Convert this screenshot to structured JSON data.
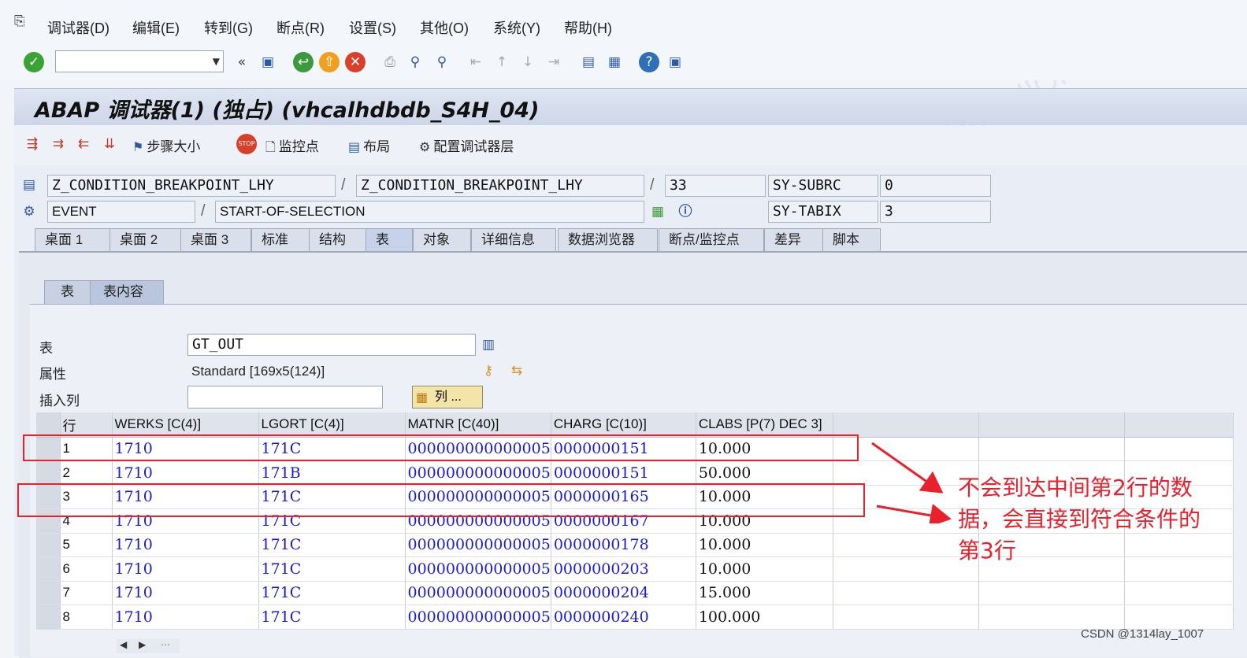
{
  "menu": {
    "items": [
      "调试器(D)",
      "编辑(E)",
      "转到(G)",
      "断点(R)",
      "设置(S)",
      "其他(O)",
      "系统(Y)",
      "帮助(H)"
    ]
  },
  "title": "ABAP 调试器(1) (独占) (vhcalhdbdb_S4H_04)",
  "app_toolbar": {
    "step_size": "步骤大小",
    "watchpoint": "监控点",
    "layout": "布局",
    "config": "配置调试器层"
  },
  "info": {
    "program1": "Z_CONDITION_BREAKPOINT_LHY",
    "program2": "Z_CONDITION_BREAKPOINT_LHY",
    "line": "33",
    "event_type": "EVENT",
    "event_name": "START-OF-SELECTION",
    "sy_subrc_label": "SY-SUBRC",
    "sy_subrc_value": "0",
    "sy_tabix_label": "SY-TABIX",
    "sy_tabix_value": "3",
    "sep": "/"
  },
  "tabs": [
    "桌面 1",
    "桌面 2",
    "桌面 3",
    "标准",
    "结构",
    "表",
    "对象",
    "详细信息",
    "数据浏览器",
    "断点/监控点",
    "差异",
    "脚本"
  ],
  "subtabs": [
    "表",
    "表内容"
  ],
  "table_panel": {
    "table_label": "表",
    "table_value": "GT_OUT",
    "attr_label": "属性",
    "attr_value": "Standard [169x5(124)]",
    "insert_label": "插入列",
    "insert_value": "",
    "col_button": "列 ..."
  },
  "grid": {
    "headers": [
      "行",
      "WERKS [C(4)]",
      "LGORT [C(4)]",
      "MATNR [C(40)]",
      "CHARG [C(10)]",
      "CLABS [P(7) DEC 3]"
    ],
    "rows": [
      [
        "1",
        "1710",
        "171C",
        "000000000000005",
        "0000000151",
        "10.000"
      ],
      [
        "2",
        "1710",
        "171B",
        "000000000000005",
        "0000000151",
        "50.000"
      ],
      [
        "3",
        "1710",
        "171C",
        "000000000000005",
        "0000000165",
        "10.000"
      ],
      [
        "4",
        "1710",
        "171C",
        "000000000000005",
        "0000000167",
        "10.000"
      ],
      [
        "5",
        "1710",
        "171C",
        "000000000000005",
        "0000000178",
        "10.000"
      ],
      [
        "6",
        "1710",
        "171C",
        "000000000000005",
        "0000000203",
        "10.000"
      ],
      [
        "7",
        "1710",
        "171C",
        "000000000000005",
        "0000000204",
        "15.000"
      ],
      [
        "8",
        "1710",
        "171C",
        "000000000000005",
        "0000000240",
        "100.000"
      ]
    ]
  },
  "annotation": "不会到达中间第2行的数据，会直接到符合条件的第3行",
  "footer": "CSDN @1314lay_1007",
  "colors": {
    "annotation": "#e8212d",
    "cell_text": "#1a1ad2",
    "title_bg": "#cdd6e8"
  },
  "icons": [
    "menu-icon",
    "check-icon",
    "back-icon",
    "save-icon",
    "nav-back-icon",
    "nav-exit-icon",
    "cancel-icon",
    "print-icon",
    "find-icon",
    "find-next-icon",
    "page-first-icon",
    "page-prev-icon",
    "page-next-icon",
    "page-last-icon",
    "new-session-icon",
    "shortcut-icon",
    "help-icon",
    "customize-icon"
  ]
}
